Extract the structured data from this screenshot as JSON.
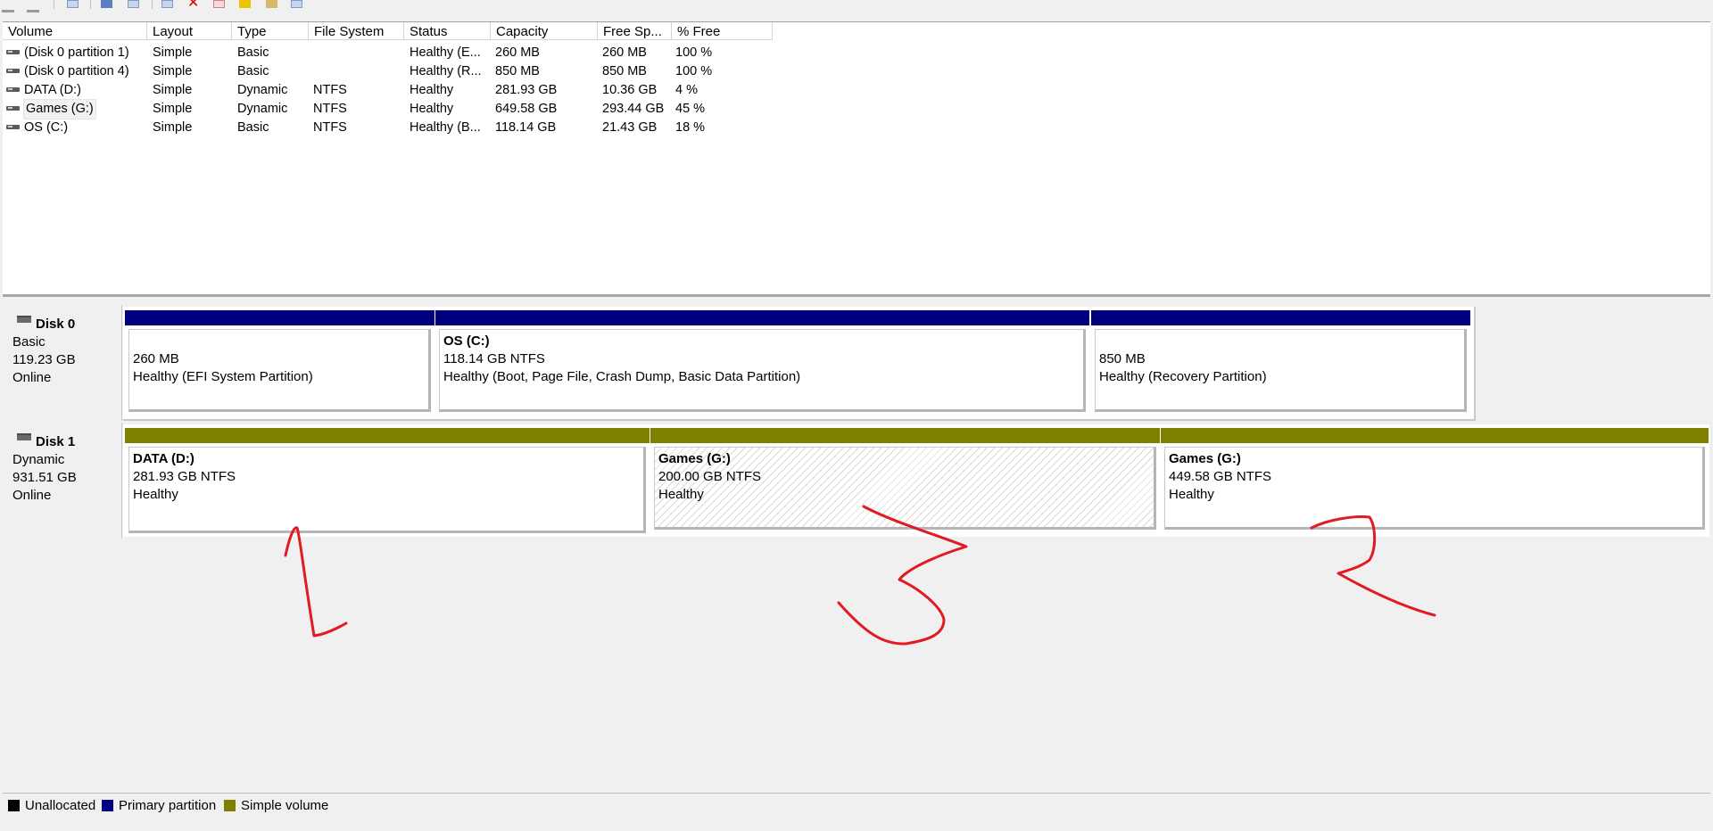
{
  "columns": [
    "Volume",
    "Layout",
    "Type",
    "File System",
    "Status",
    "Capacity",
    "Free Sp...",
    "% Free"
  ],
  "volumes": [
    {
      "name": "(Disk 0 partition 1)",
      "layout": "Simple",
      "type": "Basic",
      "fs": "",
      "status": "Healthy (E...",
      "capacity": "260 MB",
      "free": "260 MB",
      "pct": "100 %"
    },
    {
      "name": "(Disk 0 partition 4)",
      "layout": "Simple",
      "type": "Basic",
      "fs": "",
      "status": "Healthy (R...",
      "capacity": "850 MB",
      "free": "850 MB",
      "pct": "100 %"
    },
    {
      "name": "DATA (D:)",
      "layout": "Simple",
      "type": "Dynamic",
      "fs": "NTFS",
      "status": "Healthy",
      "capacity": "281.93 GB",
      "free": "10.36 GB",
      "pct": "4 %"
    },
    {
      "name": "Games (G:)",
      "layout": "Simple",
      "type": "Dynamic",
      "fs": "NTFS",
      "status": "Healthy",
      "capacity": "649.58 GB",
      "free": "293.44 GB",
      "pct": "45 %"
    },
    {
      "name": "OS (C:)",
      "layout": "Simple",
      "type": "Basic",
      "fs": "NTFS",
      "status": "Healthy (B...",
      "capacity": "118.14 GB",
      "free": "21.43 GB",
      "pct": "18 %"
    }
  ],
  "disks": [
    {
      "name": "Disk 0",
      "type": "Basic",
      "size": "119.23 GB",
      "state": "Online",
      "partitions": [
        {
          "title": "",
          "size": "260 MB",
          "status": "Healthy (EFI System Partition)",
          "kind": "primary"
        },
        {
          "title": "OS  (C:)",
          "size": "118.14 GB NTFS",
          "status": "Healthy (Boot, Page File, Crash Dump, Basic Data Partition)",
          "kind": "primary"
        },
        {
          "title": "",
          "size": "850 MB",
          "status": "Healthy (Recovery Partition)",
          "kind": "primary"
        }
      ]
    },
    {
      "name": "Disk 1",
      "type": "Dynamic",
      "size": "931.51 GB",
      "state": "Online",
      "partitions": [
        {
          "title": "DATA  (D:)",
          "size": "281.93 GB NTFS",
          "status": "Healthy",
          "kind": "simple"
        },
        {
          "title": "Games  (G:)",
          "size": "200.00 GB NTFS",
          "status": "Healthy",
          "kind": "simple",
          "selected": true
        },
        {
          "title": "Games  (G:)",
          "size": "449.58 GB NTFS",
          "status": "Healthy",
          "kind": "simple"
        }
      ]
    }
  ],
  "legend": [
    {
      "label": "Unallocated",
      "color": "#000000"
    },
    {
      "label": "Primary partition",
      "color": "#00007f"
    },
    {
      "label": "Simple volume",
      "color": "#7f7f00"
    }
  ],
  "annotations": {
    "color": "#e01b24",
    "marks": [
      "1",
      "3",
      "2"
    ]
  }
}
